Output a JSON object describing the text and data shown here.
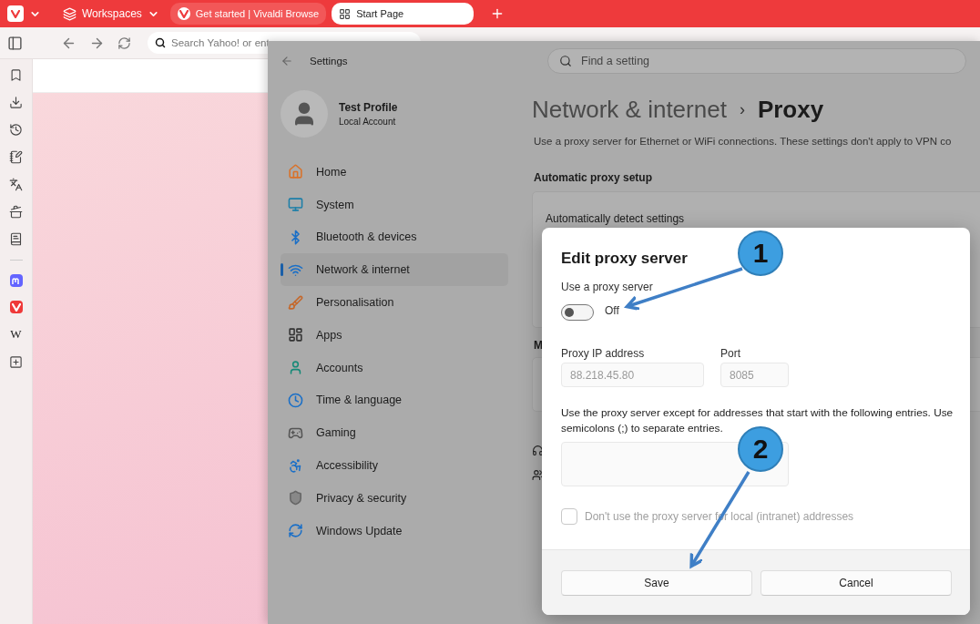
{
  "browser": {
    "workspaces": "Workspaces",
    "tabs": [
      {
        "label": "Get started | Vivaldi Browse",
        "selected": false,
        "kind": "vivaldi"
      },
      {
        "label": "Start Page",
        "selected": true,
        "kind": "grid"
      }
    ],
    "address": {
      "placeholder": "Search Yahoo! or ent"
    },
    "panel_tools": [
      {
        "kind": "bookmarks"
      },
      {
        "kind": "downloads"
      },
      {
        "kind": "history"
      },
      {
        "kind": "notes"
      },
      {
        "kind": "translate"
      },
      {
        "kind": "reading"
      },
      {
        "kind": "reader"
      }
    ],
    "web_panels": [
      {
        "kind": "mastodon"
      },
      {
        "kind": "vivaldi"
      },
      {
        "kind": "text",
        "label": "W"
      },
      {
        "kind": "add"
      }
    ]
  },
  "settings": {
    "title": "Settings",
    "search": {
      "placeholder": "Find a setting"
    },
    "profile": {
      "name": "Test Profile",
      "account": "Local Account"
    },
    "nav": [
      {
        "label": "Home",
        "selected": false,
        "kind": "home"
      },
      {
        "label": "System",
        "selected": false,
        "kind": "system"
      },
      {
        "label": "Bluetooth & devices",
        "selected": false,
        "kind": "bluetooth"
      },
      {
        "label": "Network & internet",
        "selected": true,
        "kind": "network"
      },
      {
        "label": "Personalisation",
        "selected": false,
        "kind": "brush"
      },
      {
        "label": "Apps",
        "selected": false,
        "kind": "apps"
      },
      {
        "label": "Accounts",
        "selected": false,
        "kind": "accounts"
      },
      {
        "label": "Time & language",
        "selected": false,
        "kind": "time"
      },
      {
        "label": "Gaming",
        "selected": false,
        "kind": "gaming"
      },
      {
        "label": "Accessibility",
        "selected": false,
        "kind": "accessibility"
      },
      {
        "label": "Privacy & security",
        "selected": false,
        "kind": "privacy"
      },
      {
        "label": "Windows Update",
        "selected": false,
        "kind": "update"
      }
    ],
    "breadcrumb": {
      "parent": "Network & internet",
      "separator": "›",
      "current": "Proxy"
    },
    "description": "Use a proxy server for Ethernet or WiFi connections. These settings don't apply to VPN co",
    "automatic_section": "Automatic proxy setup",
    "auto_detect": "Automatically detect settings",
    "manual_section": "M"
  },
  "dialog": {
    "title": "Edit proxy server",
    "toggle_label": "Use a proxy server",
    "toggle": {
      "on": false,
      "state_text": "Off"
    },
    "ip": {
      "label": "Proxy IP address",
      "value": "88.218.45.80",
      "disabled": true
    },
    "port": {
      "label": "Port",
      "value": "8085",
      "disabled": true
    },
    "exceptions_label": "Use the proxy server except for addresses that start with the following entries. Use semicolons (;) to separate entries.",
    "local_bypass": {
      "label": "Don't use the proxy server for local (intranet) addresses",
      "checked": false,
      "disabled": true
    },
    "buttons": [
      "Save",
      "Cancel"
    ]
  },
  "annotations": [
    {
      "label": "1"
    },
    {
      "label": "2"
    }
  ]
}
